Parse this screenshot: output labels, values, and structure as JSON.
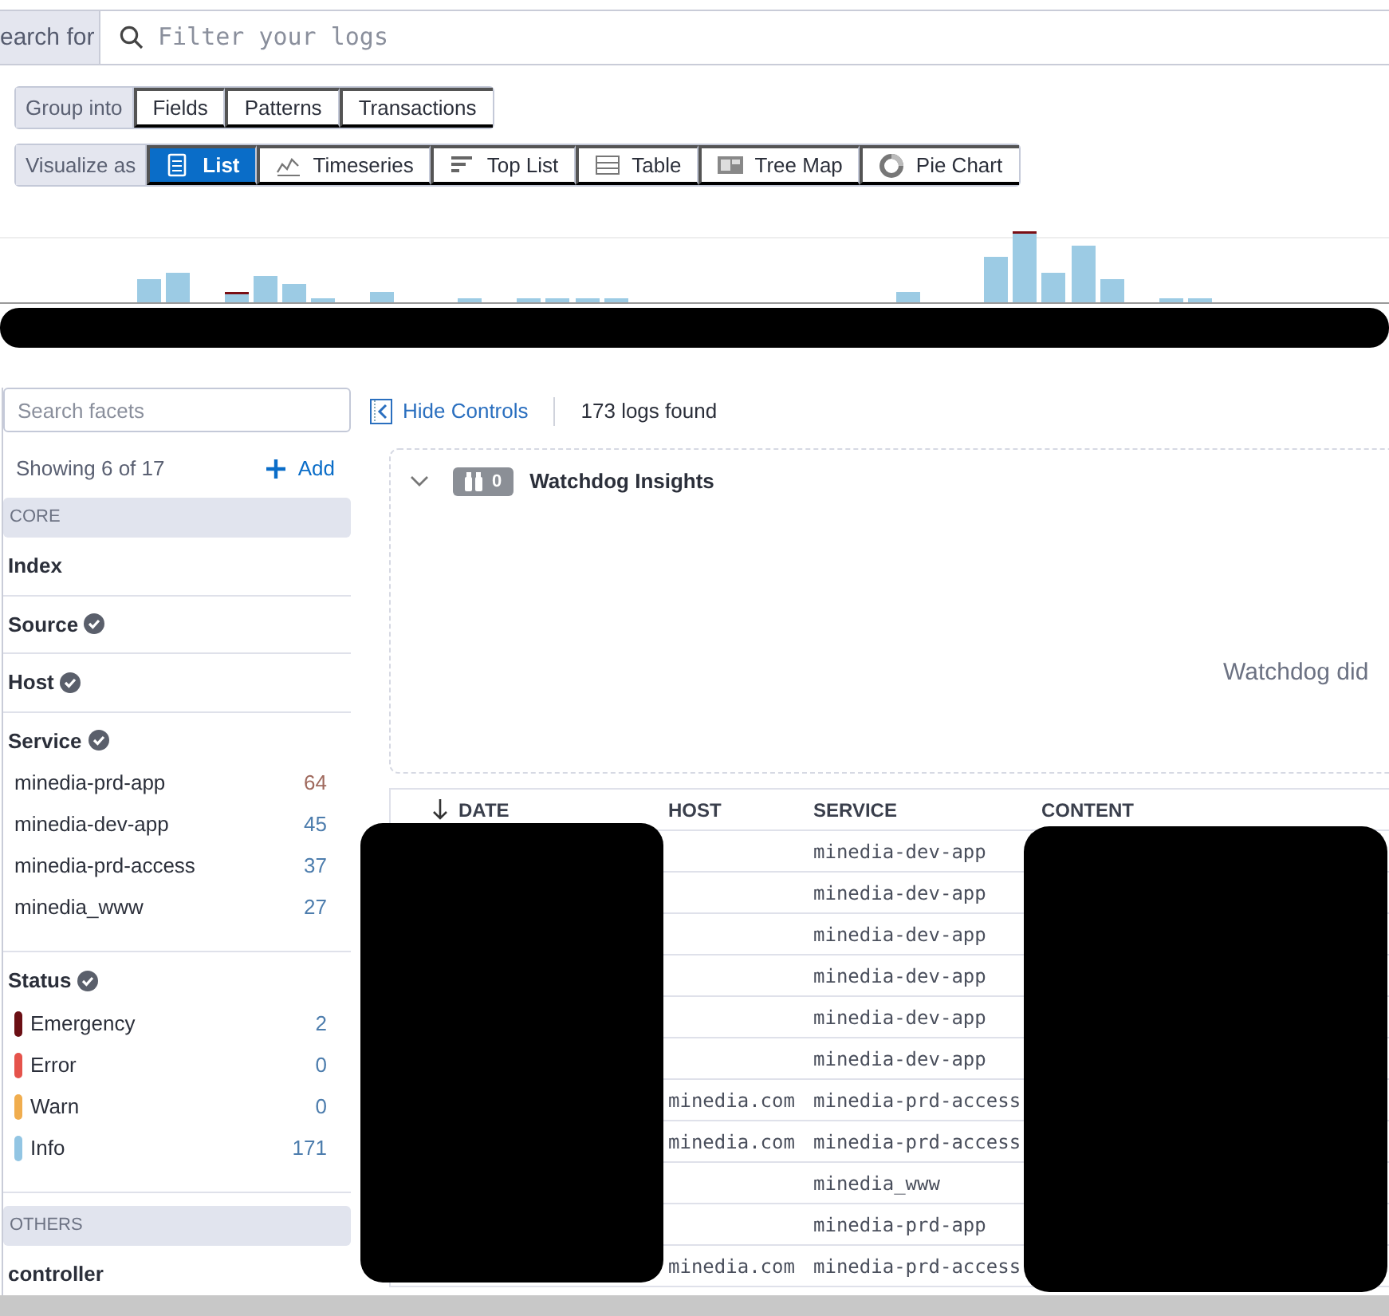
{
  "search": {
    "label": "earch for",
    "placeholder": "Filter your logs"
  },
  "group_into": {
    "label": "Group into",
    "options": [
      {
        "label": "Fields",
        "selected": false
      },
      {
        "label": "Patterns",
        "selected": false
      },
      {
        "label": "Transactions",
        "selected": false
      }
    ]
  },
  "visualize_as": {
    "label": "Visualize as",
    "options": [
      {
        "label": "List",
        "selected": true
      },
      {
        "label": "Timeseries",
        "selected": false
      },
      {
        "label": "Top List",
        "selected": false
      },
      {
        "label": "Table",
        "selected": false
      },
      {
        "label": "Tree Map",
        "selected": false
      },
      {
        "label": "Pie Chart",
        "selected": false
      }
    ]
  },
  "facets": {
    "placeholder": "Search facets",
    "showing": "Showing 6 of 17",
    "add": "Add",
    "sections": [
      {
        "title": "CORE",
        "groups": [
          {
            "name": "Index",
            "verified": false
          },
          {
            "name": "Source",
            "verified": true
          },
          {
            "name": "Host",
            "verified": true
          },
          {
            "name": "Service",
            "verified": true,
            "values": [
              {
                "label": "minedia-prd-app",
                "count": "64"
              },
              {
                "label": "minedia-dev-app",
                "count": "45"
              },
              {
                "label": "minedia-prd-access",
                "count": "37"
              },
              {
                "label": "minedia_www",
                "count": "27"
              }
            ]
          },
          {
            "name": "Status",
            "verified": true,
            "values": [
              {
                "label": "Emergency",
                "count": "2",
                "color": "#6b0f14"
              },
              {
                "label": "Error",
                "count": "0",
                "color": "#e5534b"
              },
              {
                "label": "Warn",
                "count": "0",
                "color": "#f0ad4e"
              },
              {
                "label": "Info",
                "count": "171",
                "color": "#92c5e3"
              }
            ]
          }
        ]
      },
      {
        "title": "OTHERS",
        "groups": [
          {
            "name": "controller",
            "verified": false
          }
        ]
      }
    ]
  },
  "toolbar": {
    "hide_controls": "Hide Controls",
    "count": "173 logs found"
  },
  "watchdog": {
    "expanded": true,
    "badge": "0",
    "title": "Watchdog Insights",
    "message": "Watchdog did"
  },
  "table": {
    "columns": [
      "DATE",
      "HOST",
      "SERVICE",
      "CONTENT"
    ],
    "rows": [
      {
        "host": "",
        "service": "minedia-dev-app"
      },
      {
        "host": "",
        "service": "minedia-dev-app"
      },
      {
        "host": "",
        "service": "minedia-dev-app"
      },
      {
        "host": "",
        "service": "minedia-dev-app"
      },
      {
        "host": "",
        "service": "minedia-dev-app"
      },
      {
        "host": "",
        "service": "minedia-dev-app"
      },
      {
        "host": "minedia.com",
        "service": "minedia-prd-access"
      },
      {
        "host": "minedia.com",
        "service": "minedia-prd-access"
      },
      {
        "host": "",
        "service": "minedia_www"
      },
      {
        "host": "",
        "service": "minedia-prd-app"
      },
      {
        "host": "minedia.com",
        "service": "minedia-prd-access"
      }
    ]
  }
}
